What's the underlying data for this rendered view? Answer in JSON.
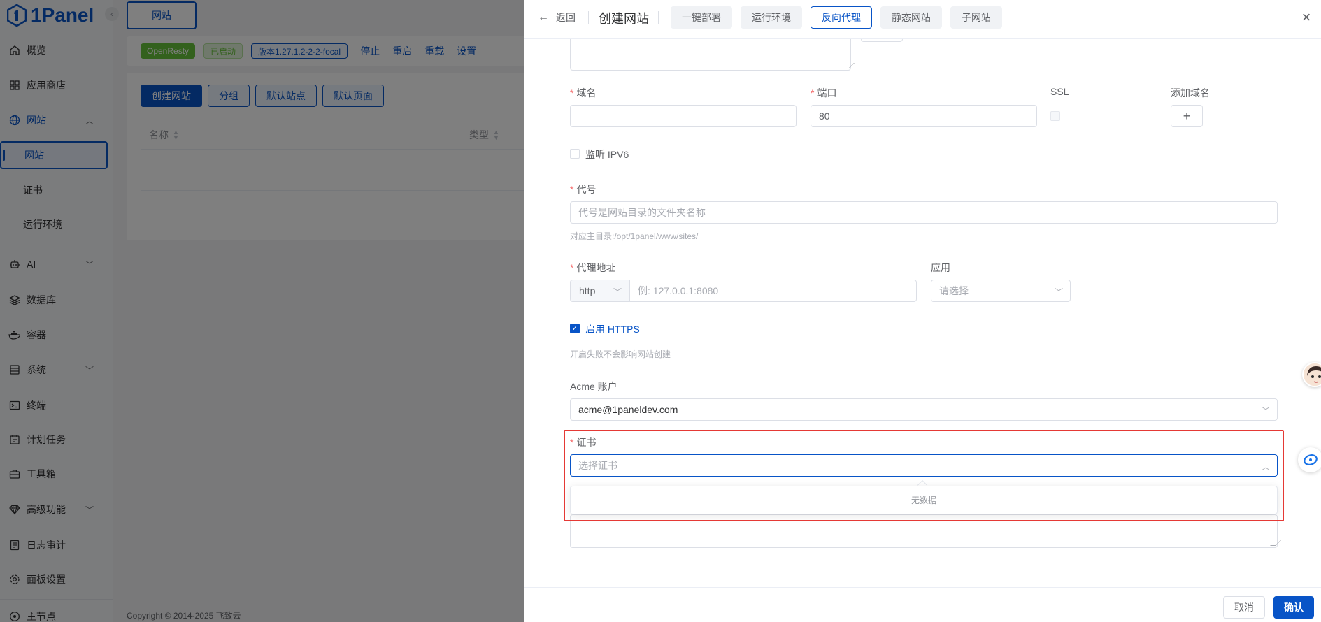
{
  "app": {
    "logo_text": "1Panel"
  },
  "sidebar": {
    "items": [
      {
        "label": "概览",
        "icon": "home-icon"
      },
      {
        "label": "应用商店",
        "icon": "grid-icon"
      },
      {
        "label": "网站",
        "icon": "globe-icon"
      },
      {
        "label": "AI",
        "icon": "robot-icon"
      },
      {
        "label": "数据库",
        "icon": "layers-icon"
      },
      {
        "label": "容器",
        "icon": "docker-icon"
      },
      {
        "label": "系统",
        "icon": "server-icon"
      },
      {
        "label": "终端",
        "icon": "terminal-icon"
      },
      {
        "label": "计划任务",
        "icon": "calendar-icon"
      },
      {
        "label": "工具箱",
        "icon": "toolbox-icon"
      },
      {
        "label": "高级功能",
        "icon": "diamond-icon"
      },
      {
        "label": "日志审计",
        "icon": "log-icon"
      },
      {
        "label": "面板设置",
        "icon": "settings-icon"
      },
      {
        "label": "主节点",
        "icon": "node-icon"
      }
    ],
    "sub_items": [
      {
        "label": "网站"
      },
      {
        "label": "证书"
      },
      {
        "label": "运行环境"
      }
    ]
  },
  "main": {
    "tab_label": "网站",
    "status": {
      "server": "OpenResty",
      "state": "已启动",
      "version": "版本1.27.1.2-2-2-focal",
      "actions": [
        "停止",
        "重启",
        "重载",
        "设置"
      ]
    },
    "toolbar": {
      "create": "创建网站",
      "group": "分组",
      "default_site": "默认站点",
      "default_page": "默认页面"
    },
    "table": {
      "col_name": "名称",
      "col_type": "类型"
    },
    "copyright": "Copyright © 2014-2025 飞致云"
  },
  "drawer": {
    "back_label": "返回",
    "title": "创建网站",
    "types": [
      "一键部署",
      "运行环境",
      "反向代理",
      "静态网站",
      "子网站"
    ],
    "active_type": "反向代理",
    "form": {
      "domain_label": "域名",
      "port_label": "端口",
      "port_value": "80",
      "ssl_label": "SSL",
      "add_domain_label": "添加域名",
      "ipv6_label": "监听 IPV6",
      "alias_label": "代号",
      "alias_placeholder": "代号是网站目录的文件夹名称",
      "alias_hint": "对应主目录:/opt/1panel/www/sites/",
      "proxy_label": "代理地址",
      "proxy_scheme": "http",
      "proxy_placeholder": "例: 127.0.0.1:8080",
      "app_label": "应用",
      "app_placeholder": "请选择",
      "https_label": "启用 HTTPS",
      "https_hint": "开启失败不会影响网站创建",
      "acme_label": "Acme 账户",
      "acme_value": "acme@1paneldev.com",
      "cert_label": "证书",
      "cert_placeholder": "选择证书",
      "cert_empty": "无数据"
    },
    "footer": {
      "cancel": "取消",
      "confirm": "确认"
    }
  },
  "colors": {
    "primary": "#0854c7",
    "danger": "#e53935",
    "success": "#67c23a"
  }
}
